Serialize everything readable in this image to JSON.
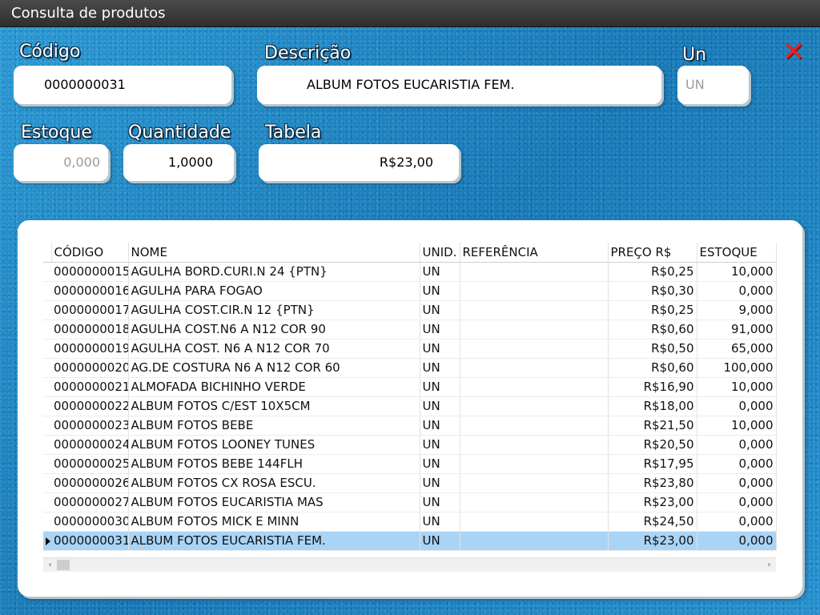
{
  "window": {
    "title": "Consulta de produtos"
  },
  "form": {
    "codigo_label": "Código",
    "codigo_value": "0000000031",
    "descricao_label": "Descrição",
    "descricao_value": "ALBUM FOTOS EUCARISTIA FEM.",
    "un_label": "Un",
    "un_value": "UN",
    "estoque_label": "Estoque",
    "estoque_value": "0,000",
    "quantidade_label": "Quantidade",
    "quantidade_value": "1,0000",
    "tabela_label": "Tabela",
    "tabela_value": "R$23,00"
  },
  "icons": {
    "close": "close-icon"
  },
  "colors": {
    "close": "#e02424",
    "selection": "#a9d4f6"
  },
  "grid": {
    "columns": [
      "CÓDIGO",
      "NOME",
      "UNID.",
      "REFERÊNCIA",
      "PREÇO R$",
      "ESTOQUE"
    ],
    "rows": [
      [
        "0000000015",
        "AGULHA BORD.CURI.N 24 {PTN}",
        "UN",
        "",
        "R$0,25",
        "10,000"
      ],
      [
        "0000000016",
        "AGULHA PARA FOGAO",
        "UN",
        "",
        "R$0,30",
        "0,000"
      ],
      [
        "0000000017",
        "AGULHA COST.CIR.N 12 {PTN}",
        "UN",
        "",
        "R$0,25",
        "9,000"
      ],
      [
        "0000000018",
        "AGULHA COST.N6 A N12 COR 90",
        "UN",
        "",
        "R$0,60",
        "91,000"
      ],
      [
        "0000000019",
        "AGULHA COST. N6 A N12 COR 70",
        "UN",
        "",
        "R$0,50",
        "65,000"
      ],
      [
        "0000000020",
        "AG.DE COSTURA N6 A N12 COR 60",
        "UN",
        "",
        "R$0,60",
        "100,000"
      ],
      [
        "0000000021",
        "ALMOFADA BICHINHO VERDE",
        "UN",
        "",
        "R$16,90",
        "10,000"
      ],
      [
        "0000000022",
        "ALBUM FOTOS C/EST 10X5CM",
        "UN",
        "",
        "R$18,00",
        "0,000"
      ],
      [
        "0000000023",
        "ALBUM FOTOS BEBE",
        "UN",
        "",
        "R$21,50",
        "10,000"
      ],
      [
        "0000000024",
        "ALBUM FOTOS LOONEY TUNES",
        "UN",
        "",
        "R$20,50",
        "0,000"
      ],
      [
        "0000000025",
        "ALBUM FOTOS BEBE 144FLH",
        "UN",
        "",
        "R$17,95",
        "0,000"
      ],
      [
        "0000000026",
        "ALBUM FOTOS CX ROSA ESCU.",
        "UN",
        "",
        "R$23,80",
        "0,000"
      ],
      [
        "0000000027",
        "ALBUM FOTOS EUCARISTIA MAS",
        "UN",
        "",
        "R$23,00",
        "0,000"
      ],
      [
        "0000000030",
        "ALBUM FOTOS MICK E MINN",
        "UN",
        "",
        "R$24,50",
        "0,000"
      ],
      [
        "0000000031",
        "ALBUM FOTOS EUCARISTIA FEM.",
        "UN",
        "",
        "R$23,00",
        "0,000"
      ]
    ],
    "selected_row": 14
  },
  "scrollbar": {
    "left_arrow": "‹",
    "right_arrow": "›"
  }
}
